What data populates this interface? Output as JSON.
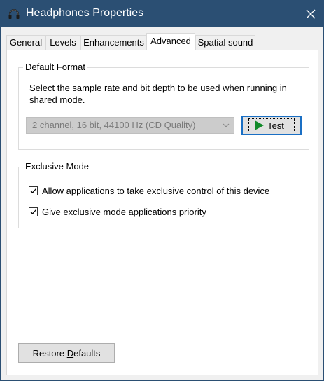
{
  "window": {
    "title": "Headphones Properties",
    "icon": "headphones-icon",
    "titlebar_color": "#2b4f73"
  },
  "tabs": [
    {
      "label": "General",
      "active": false
    },
    {
      "label": "Levels",
      "active": false
    },
    {
      "label": "Enhancements",
      "active": false
    },
    {
      "label": "Advanced",
      "active": true
    },
    {
      "label": "Spatial sound",
      "active": false
    }
  ],
  "default_format": {
    "title": "Default Format",
    "description": "Select the sample rate and bit depth to be used when running in shared mode.",
    "selected_format": "2 channel, 16 bit, 44100 Hz (CD Quality)",
    "test_button": {
      "prefix": "",
      "accel": "T",
      "suffix": "est",
      "icon": "play-icon",
      "accent": "#1a6fc4"
    }
  },
  "exclusive_mode": {
    "title": "Exclusive Mode",
    "options": [
      {
        "label": "Allow applications to take exclusive control of this device",
        "checked": true
      },
      {
        "label": "Give exclusive mode applications priority",
        "checked": true
      }
    ]
  },
  "restore_button": {
    "prefix": "Restore ",
    "accel": "D",
    "suffix": "efaults"
  }
}
